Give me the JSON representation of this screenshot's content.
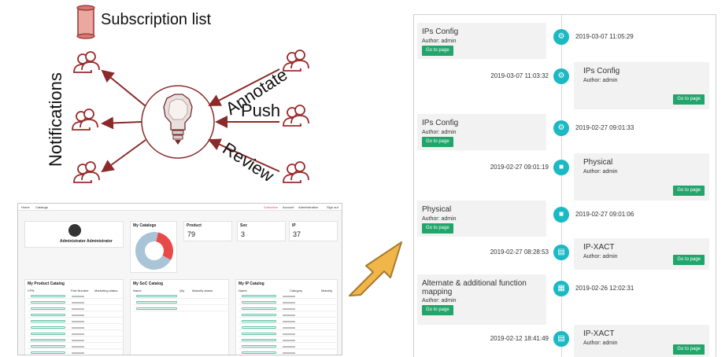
{
  "diagram": {
    "subscription_label": "Subscription list",
    "notifications_label": "Notifications",
    "actions": {
      "annotate": "Annotate",
      "push": "Push",
      "review": "Review"
    },
    "arrow_color": "#8b2a2a",
    "icons": {
      "scroll": "scroll-icon",
      "user": "user-group-icon",
      "hub": "lightbulb-icon"
    }
  },
  "dashboard": {
    "breadcrumb": {
      "home": "Home",
      "catalogs": "Catalogs"
    },
    "nav": {
      "subscribe": "Subscribe",
      "account": "Account",
      "administration": "Administration",
      "signout": "Sign out"
    },
    "profile_name": "Administrator Administrator",
    "my_catalogs": "My Catalogs",
    "stats": [
      {
        "label": "Product",
        "value": "79"
      },
      {
        "label": "Soc",
        "value": "3"
      },
      {
        "label": "IP",
        "value": "37"
      }
    ],
    "donut": [
      {
        "color": "#e84a4a",
        "fraction": 0.3
      },
      {
        "color": "#a9c4d6",
        "fraction": 0.7
      }
    ],
    "tables": [
      {
        "title": "My Product Catalog",
        "headers": [
          "CPN",
          "Part Number",
          "Marketing status"
        ]
      },
      {
        "title": "My SoC Catalog",
        "headers": [
          "Name",
          "Qty",
          "Maturity status"
        ]
      },
      {
        "title": "My IP Catalog",
        "headers": [
          "Name",
          "Category",
          "Maturity"
        ]
      }
    ]
  },
  "timeline": {
    "button_label": "Go to page",
    "accent": "#1ab9c4",
    "button_color": "#22a56b",
    "entries": [
      {
        "side": "left",
        "title": "IPs Config",
        "author": "Author: admin",
        "date": "2019-03-07 11:05:29",
        "icon": "gear-share-icon"
      },
      {
        "side": "right",
        "title": "IPs Config",
        "author": "Author: admin",
        "date": "2019-03-07 11:03:32",
        "icon": "gear-share-icon"
      },
      {
        "side": "left",
        "title": "IPs Config",
        "author": "Author: admin",
        "date": "2019-02-27 09:01:33",
        "icon": "gear-share-icon"
      },
      {
        "side": "right",
        "title": "Physical",
        "author": "Author: admin",
        "date": "2019-02-27 09:01:19",
        "icon": "cube-icon"
      },
      {
        "side": "left",
        "title": "Physical",
        "author": "Author: admin",
        "date": "2019-02-27 09:01:06",
        "icon": "cube-icon"
      },
      {
        "side": "right",
        "title": "IP-XACT",
        "author": "Author: admin",
        "date": "2019-02-27 08:28:53",
        "icon": "document-icon"
      },
      {
        "side": "left",
        "title": "Alternate & additional function mapping",
        "author": "Author: admin",
        "date": "2019-02-26 12:02:31",
        "icon": "table-icon"
      },
      {
        "side": "right",
        "title": "IP-XACT",
        "author": "Author: admin",
        "date": "2019-02-12 18:41:49",
        "icon": "document-icon"
      }
    ]
  }
}
